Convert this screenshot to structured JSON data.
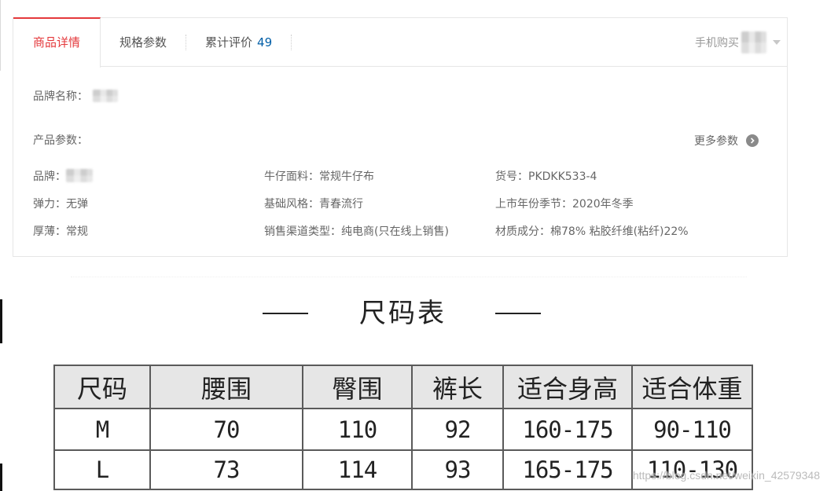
{
  "tabs": [
    {
      "label": "商品详情",
      "active": true
    },
    {
      "label": "规格参数",
      "active": false
    },
    {
      "label": "累计评价",
      "count": "49",
      "active": false
    }
  ],
  "mobile_buy": {
    "label": "手机购买",
    "icon": "qr-code-icon",
    "dropdown_icon": "chevron-down-icon"
  },
  "brand": {
    "label": "品牌名称："
  },
  "params": {
    "title": "产品参数：",
    "more_label": "更多参数",
    "more_icon": "arrow-right-circle-icon",
    "items": [
      "品牌：",
      "牛仔面料：常规牛仔布",
      "货号：PKDKK533-4",
      "弹力：无弹",
      "基础风格：青春流行",
      "上市年份季节：2020年冬季",
      "厚薄：常规",
      "销售渠道类型：纯电商(只在线上销售)",
      "材质成分：棉78% 粘胶纤维(粘纤)22%"
    ]
  },
  "size_chart": {
    "title": "尺码表",
    "headers": [
      "尺码",
      "腰围",
      "臀围",
      "裤长",
      "适合身高",
      "适合体重"
    ],
    "rows": [
      [
        "M",
        "70",
        "110",
        "92",
        "160-175",
        "90-110"
      ],
      [
        "L",
        "73",
        "114",
        "93",
        "165-175",
        "110-130"
      ]
    ]
  },
  "watermark": "https://blog.csdn.net/weixin_42579348",
  "colors": {
    "accent": "#e4393c",
    "count_blue": "#005ea7",
    "text": "#666666",
    "muted": "#999999",
    "border": "#e6e6e6",
    "table_border": "#5a5a5a",
    "table_header_bg": "#e6e6e6",
    "chart_text": "#222222"
  }
}
